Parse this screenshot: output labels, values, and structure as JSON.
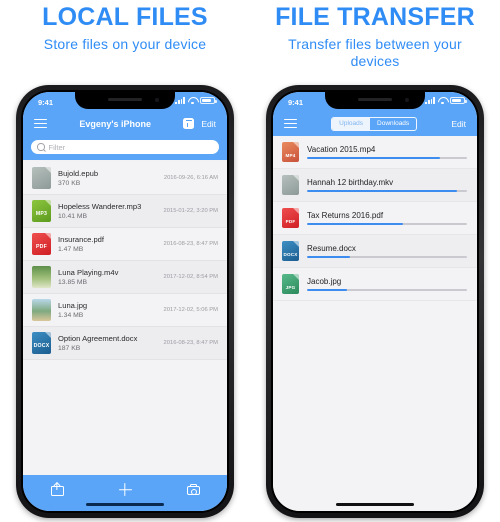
{
  "colors": {
    "accent": "#2f8cf5",
    "nav_blue": "#5aa5f7",
    "progress": "#3d8cf0",
    "list_bg": "#f3f3f5"
  },
  "panels": [
    {
      "title": "LOCAL FILES",
      "subtitle": "Store files on your device",
      "statusbar": {
        "time": "9:41",
        "signal_icon": "signal-bars-icon",
        "wifi_icon": "wifi-icon",
        "battery_icon": "battery-icon"
      },
      "navbar": {
        "menu_icon": "hamburger-menu-icon",
        "title": "Evgeny's iPhone",
        "action_icon": "add-folder-icon",
        "edit_label": "Edit"
      },
      "search": {
        "icon": "search-icon",
        "placeholder": "Filter",
        "value": ""
      },
      "files": [
        {
          "name": "Bujold.epub",
          "size": "370 KB",
          "date": "2016-09-26, 6:16 AM",
          "badge": "",
          "icon_class": "grey"
        },
        {
          "name": "Hopeless Wanderer.mp3",
          "size": "10.41 MB",
          "date": "2015-01-22, 3:20 PM",
          "badge": "MP3",
          "icon_class": "mp3"
        },
        {
          "name": "Insurance.pdf",
          "size": "1.47 MB",
          "date": "2016-08-23, 8:47 PM",
          "badge": "PDF",
          "icon_class": "pdf"
        },
        {
          "name": "Luna Playing.m4v",
          "size": "13.85 MB",
          "date": "2017-12-02, 8:54 PM",
          "badge": "",
          "icon_class": "thumb-video"
        },
        {
          "name": "Luna.jpg",
          "size": "1.34 MB",
          "date": "2017-12-02, 5:06 PM",
          "badge": "",
          "icon_class": "thumb-photo"
        },
        {
          "name": "Option Agreement.docx",
          "size": "187 KB",
          "date": "2016-08-23, 8:47 PM",
          "badge": "DOCX",
          "icon_class": "docx"
        }
      ],
      "toolbar": {
        "share_icon": "share-upload-icon",
        "add_icon": "plus-icon",
        "camera_icon": "camera-icon"
      }
    },
    {
      "title": "FILE TRANSFER",
      "subtitle": "Transfer files between your devices",
      "statusbar": {
        "time": "9:41",
        "signal_icon": "signal-bars-icon",
        "wifi_icon": "wifi-icon",
        "battery_icon": "battery-icon"
      },
      "navbar": {
        "menu_icon": "hamburger-menu-icon",
        "edit_label": "Edit",
        "segments": [
          {
            "label": "Uploads",
            "active": true
          },
          {
            "label": "Downloads",
            "active": false
          }
        ]
      },
      "transfers": [
        {
          "name": "Vacation 2015.mp4",
          "badge": "MP4",
          "icon_class": "mp4",
          "progress": 83
        },
        {
          "name": "Hannah 12 birthday.mkv",
          "badge": "",
          "icon_class": "grey",
          "progress": 94
        },
        {
          "name": "Tax Returns 2016.pdf",
          "badge": "PDF",
          "icon_class": "pdf",
          "progress": 60
        },
        {
          "name": "Resume.docx",
          "badge": "DOCX",
          "icon_class": "docx",
          "progress": 27
        },
        {
          "name": "Jacob.jpg",
          "badge": "JPG",
          "icon_class": "jpg",
          "progress": 25
        }
      ]
    }
  ]
}
